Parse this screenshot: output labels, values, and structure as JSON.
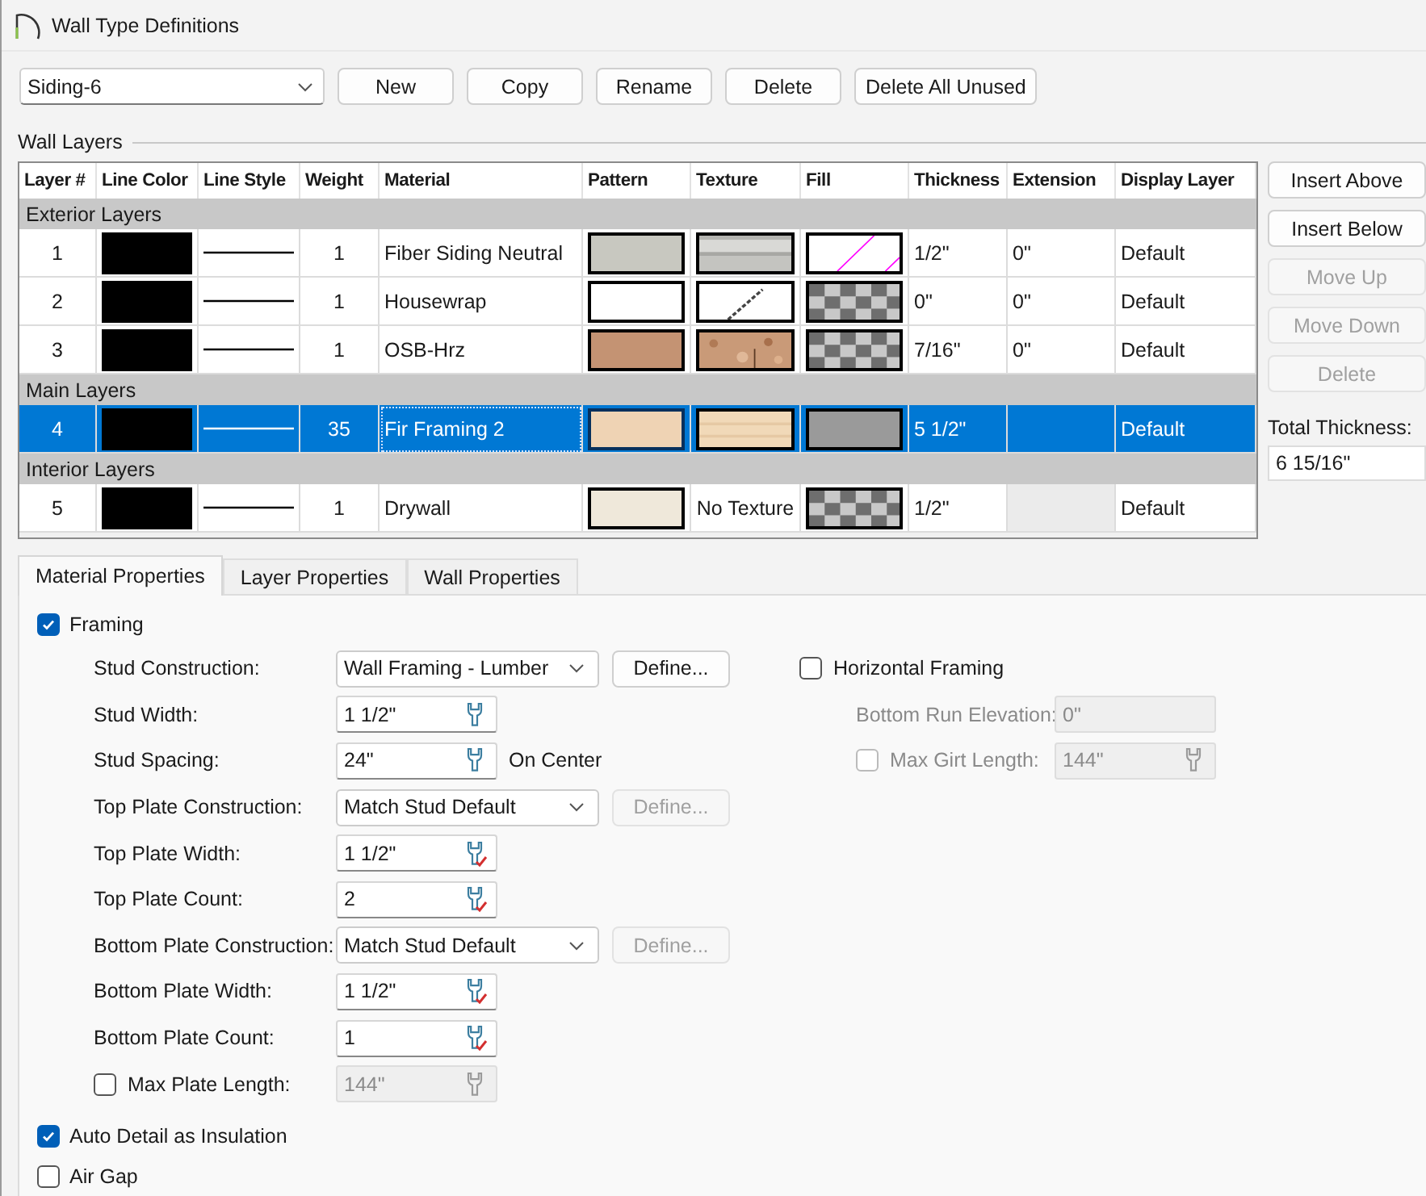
{
  "window": {
    "title": "Wall Type Definitions"
  },
  "toolbar": {
    "wall_type": "Siding-6",
    "buttons": [
      {
        "label": "New",
        "disabled": false
      },
      {
        "label": "Copy",
        "disabled": false
      },
      {
        "label": "Rename",
        "disabled": false
      },
      {
        "label": "Delete",
        "disabled": false
      },
      {
        "label": "Delete All Unused",
        "disabled": false
      }
    ]
  },
  "wall_layers": {
    "title": "Wall Layers",
    "columns": [
      "Layer #",
      "Line Color",
      "Line Style",
      "Weight",
      "Material",
      "Pattern",
      "Texture",
      "Fill",
      "Thickness",
      "Extension",
      "Display Layer"
    ],
    "rows": [
      {
        "kind": "group",
        "label": "Exterior Layers"
      },
      {
        "kind": "layer",
        "number": "1",
        "weight": "1",
        "material": "Fiber Siding Neutral",
        "pattern": {
          "color": "#c8c8c0"
        },
        "texture": {
          "kind": "siding"
        },
        "fill": {
          "kind": "hatch"
        },
        "thickness": "1/2\"",
        "extension": "0\"",
        "display_layer": "Default",
        "selected": false,
        "extension_disabled": false
      },
      {
        "kind": "layer",
        "number": "2",
        "weight": "1",
        "material": "Housewrap",
        "pattern": {
          "color": "#ffffff"
        },
        "texture": {
          "kind": "paper"
        },
        "fill": {
          "kind": "checker"
        },
        "thickness": "0\"",
        "extension": "0\"",
        "display_layer": "Default",
        "selected": false,
        "extension_disabled": false
      },
      {
        "kind": "layer",
        "number": "3",
        "weight": "1",
        "material": "OSB-Hrz",
        "pattern": {
          "color": "#c49373"
        },
        "texture": {
          "kind": "osb"
        },
        "fill": {
          "kind": "checker"
        },
        "thickness": "7/16\"",
        "extension": "0\"",
        "display_layer": "Default",
        "selected": false,
        "extension_disabled": false
      },
      {
        "kind": "group",
        "label": "Main Layers"
      },
      {
        "kind": "layer",
        "number": "4",
        "weight": "35",
        "material": "Fir Framing 2",
        "pattern": {
          "color": "#efd3b4"
        },
        "texture": {
          "kind": "wood"
        },
        "fill": {
          "kind": "solid"
        },
        "thickness": "5 1/2\"",
        "display_layer": "Default",
        "selected": true,
        "extension_disabled": true
      },
      {
        "kind": "group",
        "label": "Interior Layers"
      },
      {
        "kind": "layer",
        "number": "5",
        "weight": "1",
        "material": "Drywall",
        "pattern": {
          "color": "#efe8da"
        },
        "texture": {
          "kind": "none",
          "label": "No Texture"
        },
        "fill": {
          "kind": "checker"
        },
        "thickness": "1/2\"",
        "display_layer": "Default",
        "selected": false,
        "extension_disabled": true
      }
    ],
    "side_buttons": [
      {
        "label": "Insert Above",
        "disabled": false
      },
      {
        "label": "Insert Below",
        "disabled": false
      },
      {
        "label": "Move Up",
        "disabled": true
      },
      {
        "label": "Move Down",
        "disabled": true
      },
      {
        "label": "Delete",
        "disabled": true
      }
    ],
    "total_thickness": {
      "label": "Total Thickness:",
      "value": "6 15/16\""
    }
  },
  "tabs": [
    {
      "label": "Material Properties",
      "selected": true
    },
    {
      "label": "Layer Properties",
      "selected": false
    },
    {
      "label": "Wall Properties",
      "selected": false
    }
  ],
  "material_properties": {
    "framing": {
      "label": "Framing",
      "checked": true
    },
    "fields": [
      {
        "kind": "select",
        "label": "Stud Construction:",
        "value": "Wall Framing - Lumber",
        "button": {
          "label": "Define...",
          "disabled": false
        }
      },
      {
        "kind": "wrench-input",
        "label": "Stud Width:",
        "value": "1 1/2\"",
        "disabled": false
      },
      {
        "kind": "wrench-input",
        "label": "Stud Spacing:",
        "value": "24\"",
        "suffix": "On Center",
        "disabled": false
      },
      {
        "kind": "select",
        "label": "Top Plate Construction:",
        "value": "Match Stud Default",
        "button": {
          "label": "Define...",
          "disabled": true
        }
      },
      {
        "kind": "default-input",
        "label": "Top Plate Width:",
        "value": "1 1/2\"",
        "disabled": false
      },
      {
        "kind": "default-input",
        "label": "Top Plate Count:",
        "value": "2",
        "disabled": false
      },
      {
        "kind": "select",
        "label": "Bottom Plate Construction:",
        "value": "Match Stud Default",
        "button": {
          "label": "Define...",
          "disabled": true
        }
      },
      {
        "kind": "default-input",
        "label": "Bottom Plate Width:",
        "value": "1 1/2\"",
        "disabled": false
      },
      {
        "kind": "default-input",
        "label": "Bottom Plate Count:",
        "value": "1",
        "disabled": false
      },
      {
        "kind": "check-input",
        "label": "Max Plate Length:",
        "checked": false,
        "value": "144\"",
        "disabled": true
      }
    ],
    "horizontal_framing": {
      "label": "Horizontal Framing",
      "checked": false,
      "fields": [
        {
          "kind": "input",
          "label": "Bottom Run Elevation:",
          "value": "0\"",
          "disabled": true
        },
        {
          "kind": "check-input",
          "label": "Max Girt Length:",
          "checked": false,
          "value": "144\"",
          "disabled": true
        }
      ]
    },
    "options": [
      {
        "label": "Auto Detail as Insulation",
        "checked": true
      },
      {
        "label": "Air Gap",
        "checked": false
      }
    ]
  }
}
